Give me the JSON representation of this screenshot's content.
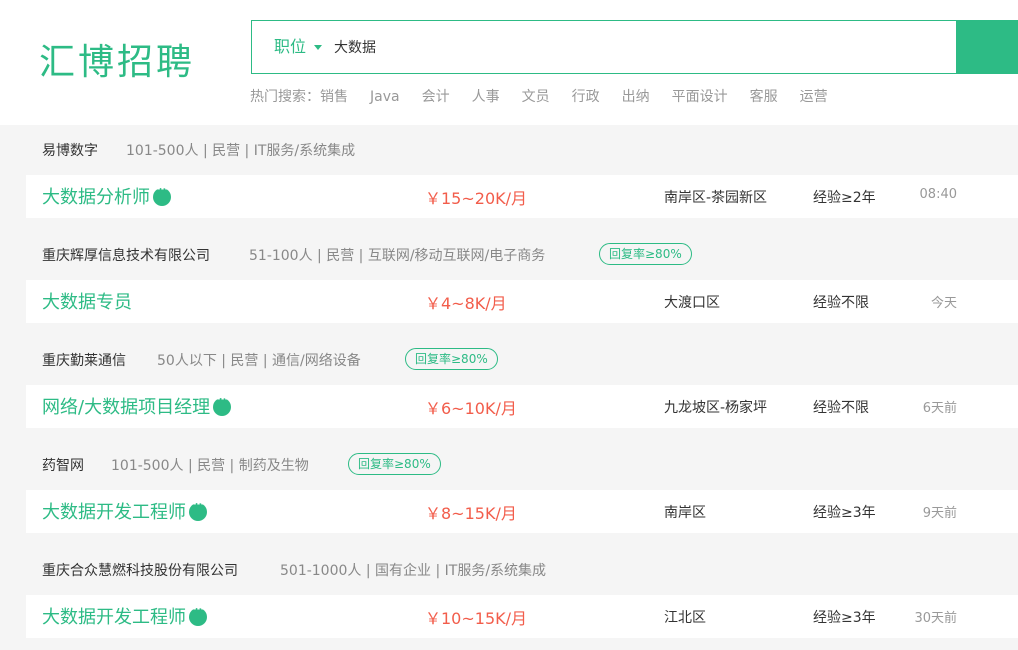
{
  "logo": "汇博招聘",
  "search": {
    "type_label": "职位",
    "value": "大数据"
  },
  "hot": {
    "label": "热门搜索：",
    "links": [
      "销售",
      "Java",
      "会计",
      "人事",
      "文员",
      "行政",
      "出纳",
      "平面设计",
      "客服",
      "运营"
    ]
  },
  "colors": {
    "brand": "#2dbb85",
    "salary": "#f25d4b"
  },
  "jobs": [
    {
      "company": "易博数字",
      "company_info": "101-500人 | 民营 | IT服务/系统集成",
      "reply_badge": "",
      "title": "大数据分析师",
      "has_chat_icon": true,
      "salary": "￥15~20K/月",
      "location": "南岸区-茶园新区",
      "experience": "经验≥2年",
      "time": "08:40"
    },
    {
      "company": "重庆辉厚信息技术有限公司",
      "company_info": "51-100人 | 民营 | 互联网/移动互联网/电子商务",
      "reply_badge": "回复率≥80%",
      "title": "大数据专员",
      "has_chat_icon": false,
      "salary": "￥4~8K/月",
      "location": "大渡口区",
      "experience": "经验不限",
      "time": "今天"
    },
    {
      "company": "重庆勤莱通信",
      "company_info": "50人以下 | 民营 | 通信/网络设备",
      "reply_badge": "回复率≥80%",
      "title": "网络/大数据项目经理",
      "has_chat_icon": true,
      "salary": "￥6~10K/月",
      "location": "九龙坡区-杨家坪",
      "experience": "经验不限",
      "time": "6天前"
    },
    {
      "company": "药智网",
      "company_info": "101-500人 | 民营 | 制药及生物",
      "reply_badge": "回复率≥80%",
      "title": "大数据开发工程师",
      "has_chat_icon": true,
      "salary": "￥8~15K/月",
      "location": "南岸区",
      "experience": "经验≥3年",
      "time": "9天前"
    },
    {
      "company": "重庆合众慧燃科技股份有限公司",
      "company_info": "501-1000人 | 国有企业 | IT服务/系统集成",
      "reply_badge": "",
      "title": "大数据开发工程师",
      "has_chat_icon": true,
      "salary": "￥10~15K/月",
      "location": "江北区",
      "experience": "经验≥3年",
      "time": "30天前"
    }
  ]
}
